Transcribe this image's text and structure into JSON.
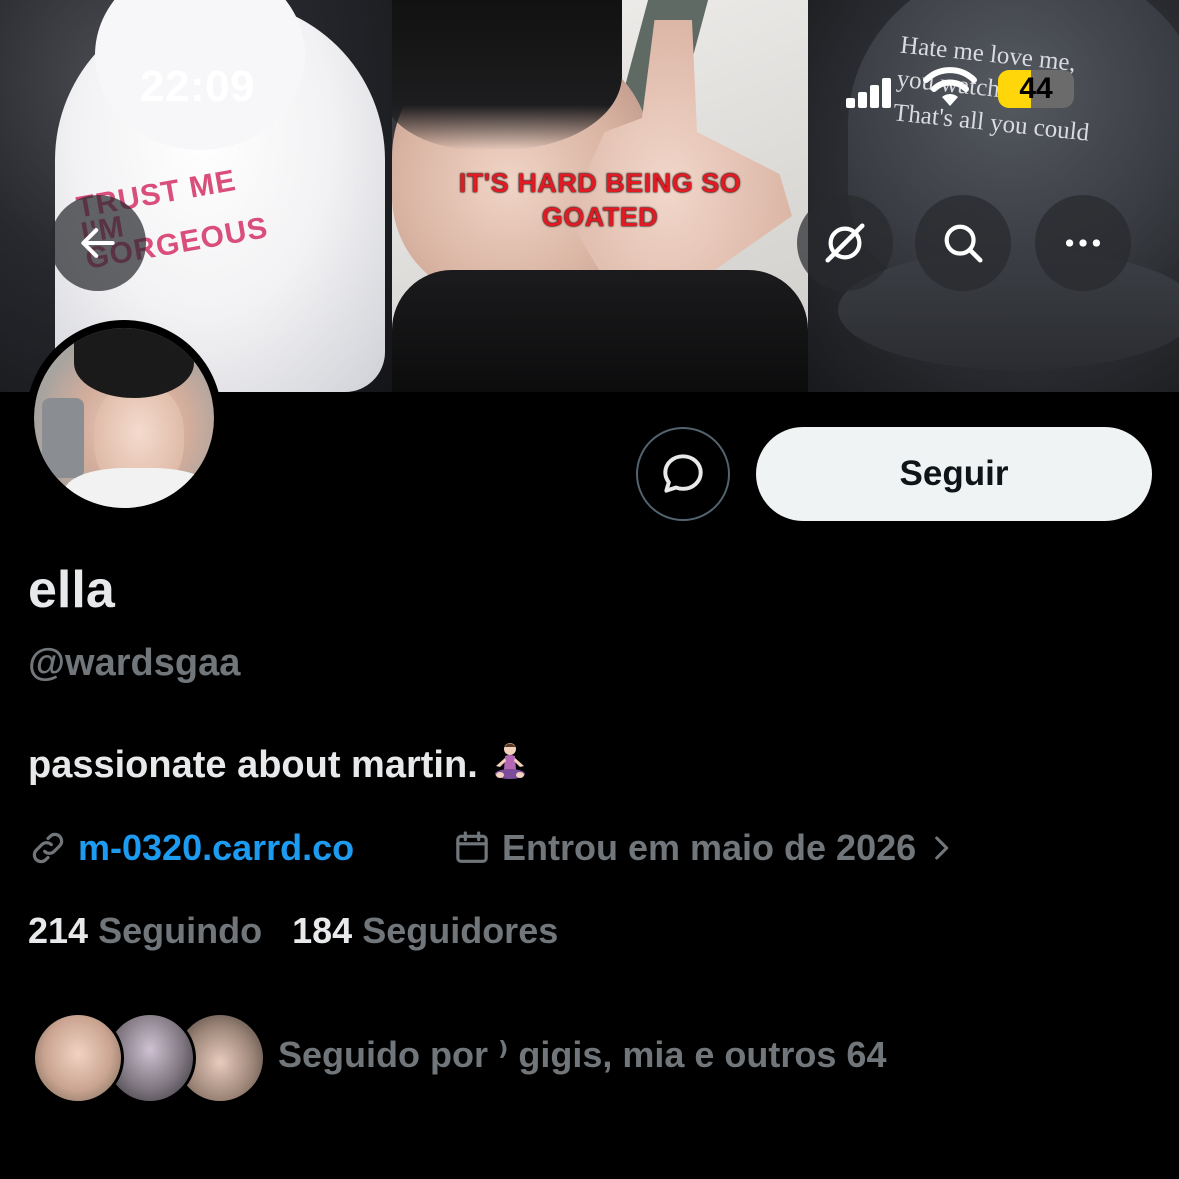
{
  "status_bar": {
    "time": "22:09",
    "battery_level": 44,
    "battery_label": "44",
    "battery_color": "#ffd60a",
    "icons": [
      "cellular-signal-icon",
      "wifi-icon",
      "battery-icon"
    ]
  },
  "banner": {
    "panel1_text": [
      "TRUST ME",
      "I'M",
      "GORGEOUS"
    ],
    "panel2_caption_line1": "IT'S HARD BEING SO",
    "panel2_caption_line2": "GOATED",
    "panel3_text": [
      "Hate me love me,",
      "you watched.",
      "That's all you could"
    ]
  },
  "nav": {
    "back_icon": "arrow-left-icon",
    "grok_icon": "grok-icon",
    "search_icon": "search-icon",
    "more_icon": "more-horizontal-icon"
  },
  "profile": {
    "display_name": "ella",
    "handle": "@wardsgaa",
    "bio": "passionate about martin.",
    "bio_emoji": "🧘🏻‍♀️",
    "link": "m-0320.carrd.co",
    "joined": "Entrou em maio de 2026",
    "following_count": "214",
    "following_label": "Seguindo",
    "followers_count": "184",
    "followers_label": "Seguidores",
    "followed_by": "Seguido por ⁾ gigis, mia e outros 64"
  },
  "actions": {
    "message_icon": "message-bubble-icon",
    "follow_label": "Seguir"
  },
  "colors": {
    "background": "#000000",
    "primary_text": "#e7e9ea",
    "secondary_text": "#71767b",
    "link": "#1d9bf0",
    "follow_button_bg": "#eff3f4",
    "banner_caption": "#e01b24"
  }
}
